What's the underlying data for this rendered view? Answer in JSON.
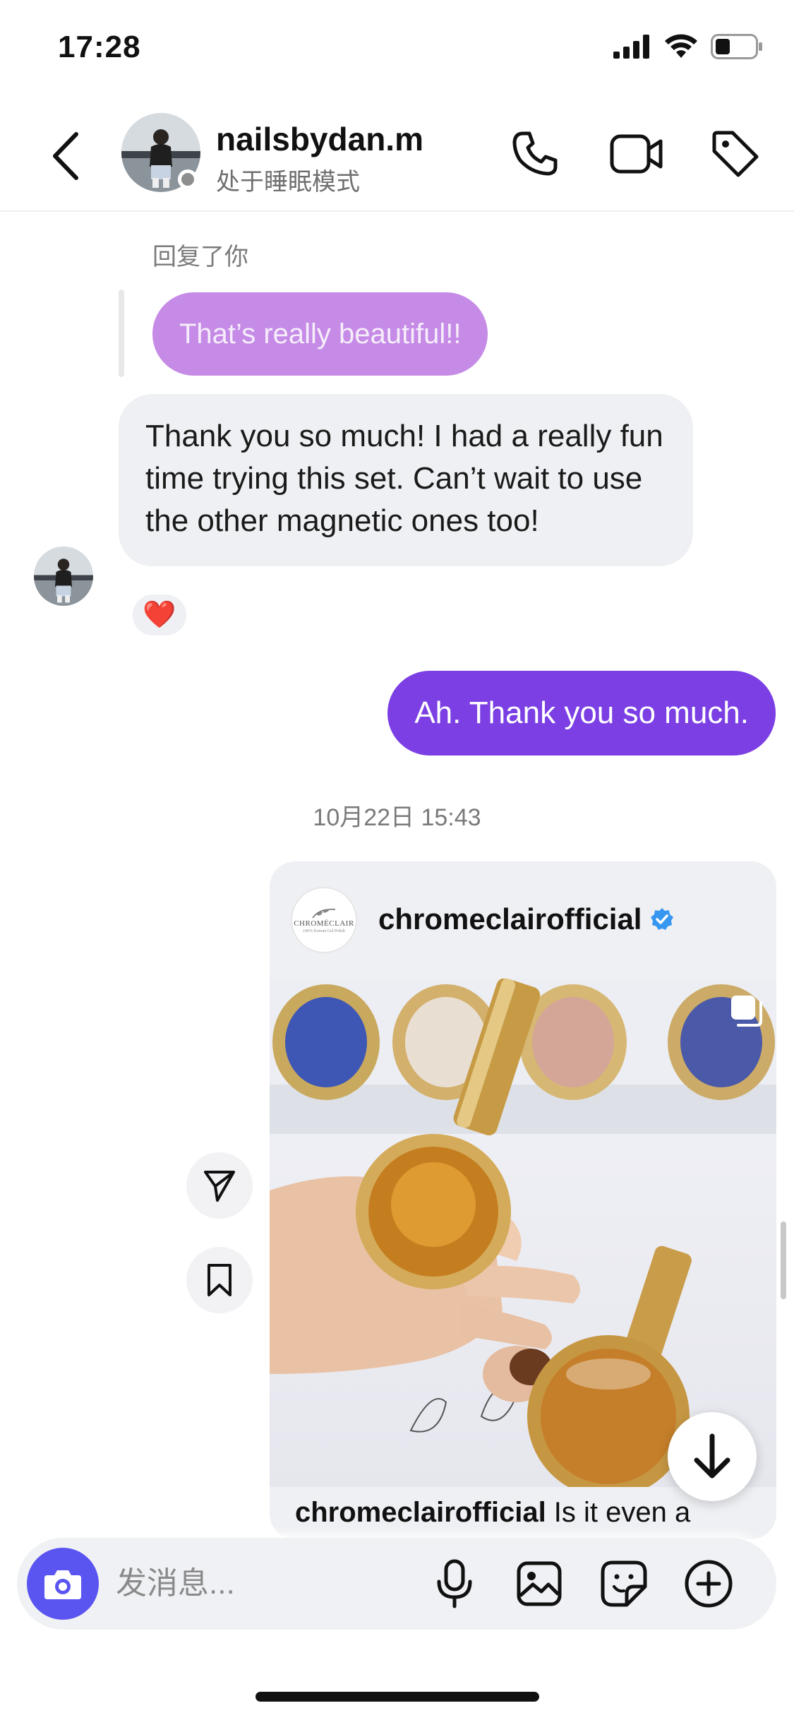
{
  "status_bar": {
    "time": "17:28",
    "icons": [
      "signal-icon",
      "wifi-icon",
      "battery-icon"
    ]
  },
  "header": {
    "username": "nailsbydan.m",
    "status": "处于睡眠模式",
    "icons": [
      "back-icon",
      "phone-icon",
      "video-icon",
      "tag-icon"
    ]
  },
  "chat": {
    "reply_label": "回复了你",
    "replied_message": "That’s really beautiful!!",
    "incoming_message": "Thank you so much! I had a really fun time trying this set. Can’t wait to use the other magnetic ones too!",
    "reaction": "❤️",
    "outgoing_message": "Ah. Thank you so much.",
    "timestamp": "10月22日 15:43"
  },
  "shared_post": {
    "account": "chromeclairofficial",
    "avatar_logo_text": "CHROMÉCLAIR",
    "avatar_logo_sub": "100% Korean Gel Polish",
    "verified": true,
    "caption_account": "chromeclairofficial",
    "caption_text": " Is it even a"
  },
  "composer": {
    "placeholder": "发消息...",
    "icons": [
      "camera-icon",
      "microphone-icon",
      "gallery-icon",
      "sticker-icon",
      "add-icon"
    ]
  },
  "colors": {
    "outgoing_bubble": "#7b3fe4",
    "replied_bubble": "#c58be6",
    "incoming_bubble": "#eff0f3",
    "camera_button": "#5a54f0",
    "verified_badge": "#3797f0"
  }
}
